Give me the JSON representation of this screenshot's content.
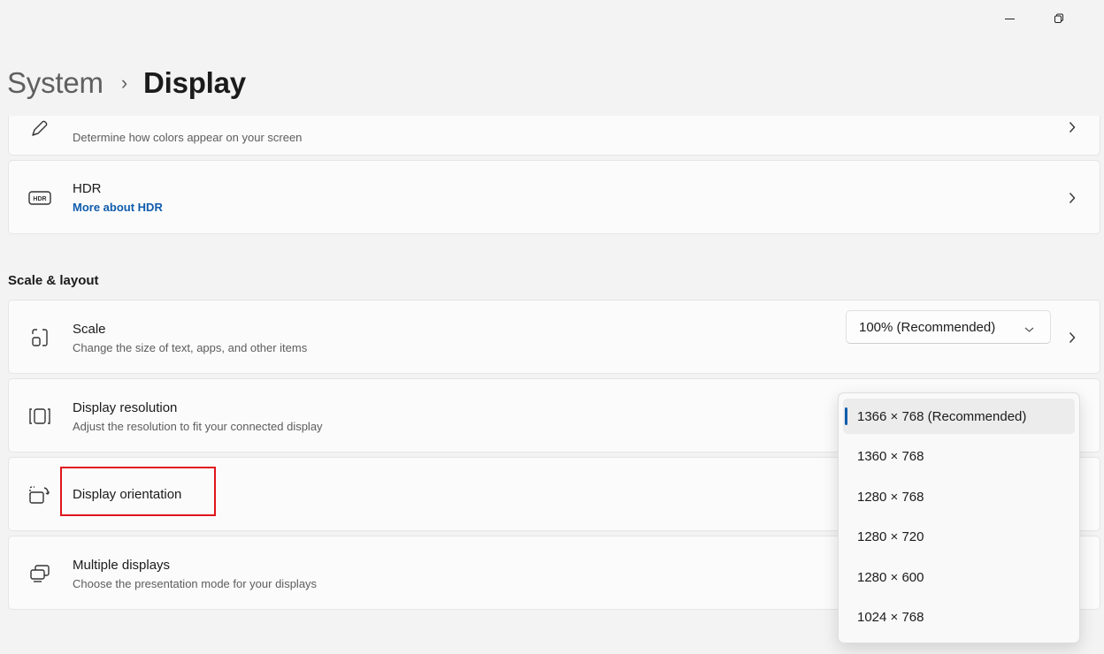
{
  "window": {
    "minimize_glyph": "minimize-icon",
    "restore_glyph": "restore-icon"
  },
  "breadcrumb": {
    "parent": "System",
    "separator": "›",
    "current": "Display"
  },
  "cards": {
    "color_profile": {
      "subtitle": "Determine how colors appear on your screen"
    },
    "hdr": {
      "icon": "hdr-icon",
      "title": "HDR",
      "link": "More about HDR"
    },
    "scale": {
      "icon": "scale-icon",
      "title": "Scale",
      "subtitle": "Change the size of text, apps, and other items",
      "selected_value": "100% (Recommended)"
    },
    "resolution": {
      "icon": "resolution-icon",
      "title": "Display resolution",
      "subtitle": "Adjust the resolution to fit your connected display"
    },
    "orientation": {
      "icon": "orientation-icon",
      "title": "Display orientation"
    },
    "multiple": {
      "icon": "multiple-displays-icon",
      "title": "Multiple displays",
      "subtitle": "Choose the presentation mode for your displays"
    }
  },
  "sections": {
    "scale_layout": "Scale & layout"
  },
  "resolution_options": [
    {
      "label": "1366 × 768 (Recommended)",
      "selected": true
    },
    {
      "label": "1360 × 768",
      "selected": false
    },
    {
      "label": "1280 × 768",
      "selected": false
    },
    {
      "label": "1280 × 720",
      "selected": false
    },
    {
      "label": "1280 × 600",
      "selected": false
    },
    {
      "label": "1024 × 768",
      "selected": false
    }
  ],
  "colors": {
    "accent": "#0f5cad",
    "highlight": "#e0151b",
    "background": "#f3f3f3"
  }
}
